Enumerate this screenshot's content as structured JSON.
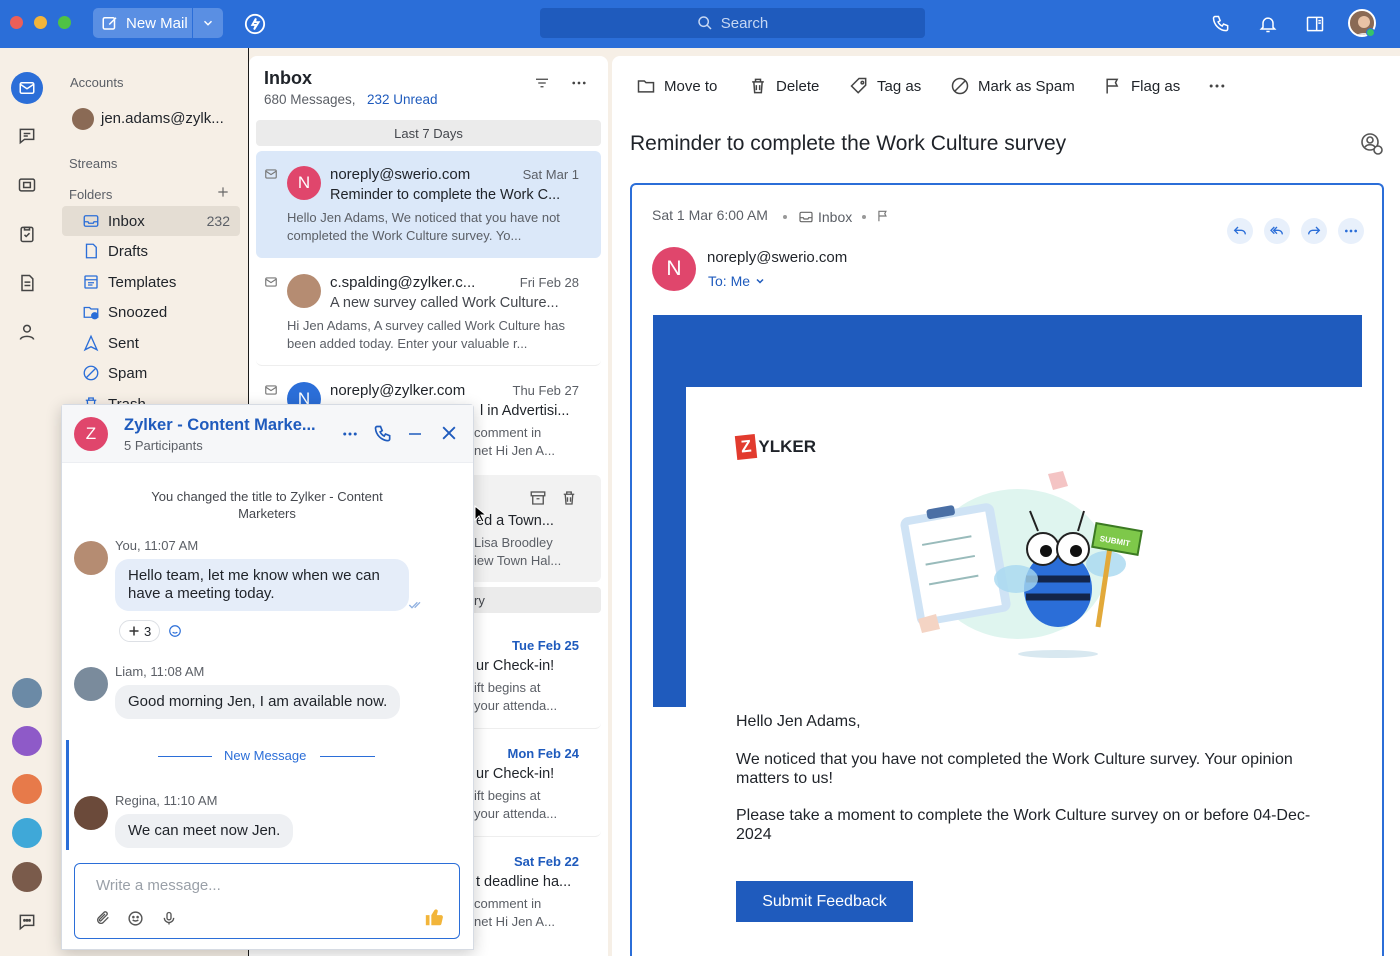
{
  "titlebar": {
    "new_mail_label": "New Mail",
    "search_placeholder": "Search",
    "icons": [
      "compose-icon",
      "chevron-down-icon",
      "lightning-icon",
      "search-icon",
      "phone-icon",
      "bell-icon",
      "reading-pane-icon",
      "avatar"
    ]
  },
  "rail": {
    "icons": [
      "mail-icon",
      "chat-icon",
      "streams-icon",
      "tasks-icon",
      "notes-icon",
      "contacts-icon",
      "chat-bubble-icon"
    ]
  },
  "folders": {
    "accounts_label": "Accounts",
    "account": "jen.adams@zylk...",
    "streams_label": "Streams",
    "folders_label": "Folders",
    "items": [
      {
        "label": "Inbox",
        "count": "232",
        "icon": "inbox-icon"
      },
      {
        "label": "Drafts",
        "count": "",
        "icon": "drafts-icon"
      },
      {
        "label": "Templates",
        "count": "",
        "icon": "templates-icon"
      },
      {
        "label": "Snoozed",
        "count": "",
        "icon": "snoozed-icon"
      },
      {
        "label": "Sent",
        "count": "",
        "icon": "sent-icon"
      },
      {
        "label": "Spam",
        "count": "",
        "icon": "spam-icon"
      },
      {
        "label": "Trash",
        "count": "",
        "icon": "trash-icon"
      }
    ]
  },
  "list": {
    "title": "Inbox",
    "count_text": "680 Messages,",
    "unread_text": "232 Unread",
    "group_last7": "Last 7 Days",
    "group_earlier": "ry",
    "mails": [
      {
        "from": "noreply@swerio.com",
        "date": "Sat Mar 1",
        "subject": "Reminder to complete the Work C...",
        "preview": "Hello Jen Adams, We noticed that you have not completed the Work Culture survey. Yo...",
        "avatar": "N"
      },
      {
        "from": "c.spalding@zylker.c...",
        "date": "Fri Feb 28",
        "subject": "A new survey called Work Culture...",
        "preview": "Hi Jen Adams, A survey called Work Culture has been added today. Enter your valuable r...",
        "avatar": ""
      },
      {
        "from": "noreply@zylker.com",
        "date": "Thu Feb 27",
        "subject": "l in Advertisi...",
        "preview_line1": "comment in",
        "preview_line2": "net Hi Jen A...",
        "avatar": "N"
      },
      {
        "subject": "ed a Town...",
        "preview_line1": "Lisa Broodley",
        "preview_line2": "iew Town Hal..."
      },
      {
        "date": "Tue Feb 25",
        "subject": "ur Check-in!",
        "preview_line1": "ift begins at",
        "preview_line2": "your attenda..."
      },
      {
        "date": "Mon Feb 24",
        "subject": "ur Check-in!",
        "preview_line1": "ift begins at",
        "preview_line2": "your attenda..."
      },
      {
        "date": "Sat Feb 22",
        "subject": "t deadline ha...",
        "preview_line1": "comment in",
        "preview_line2": "net Hi Jen A..."
      }
    ]
  },
  "reader": {
    "toolbar": {
      "move_to": "Move to",
      "delete": "Delete",
      "tag_as": "Tag as",
      "mark_spam": "Mark as Spam",
      "flag_as": "Flag as"
    },
    "subject": "Reminder to complete the Work Culture survey",
    "meta_date": "Sat 1 Mar 6:00 AM",
    "meta_folder": "Inbox",
    "sender": "noreply@swerio.com",
    "sender_avatar": "N",
    "to_label": "To: Me",
    "body": {
      "brand": "YLKER",
      "brand_letter": "Z",
      "sign_text": "SUBMIT",
      "greeting": "Hello Jen Adams,",
      "para1": "We noticed that you have not completed the Work Culture survey. Your opinion matters to us!",
      "para2": "Please take a moment to complete the Work Culture survey on or before 04-Dec-2024",
      "cta": "Submit Feedback"
    },
    "colors": {
      "brand_blue": "#1f5bbd",
      "brand_red": "#e23b2e"
    }
  },
  "chat": {
    "avatar_letter": "Z",
    "title": "Zylker - Content Marke...",
    "participants": "5 Participants",
    "system_msg": "You changed the title to Zylker - Content Marketers",
    "messages": [
      {
        "sender": "You,",
        "time": "11:07 AM",
        "text": "Hello team, let me know when we can have a meeting today."
      },
      {
        "sender": "Liam,",
        "time": "11:08 AM",
        "text": "Good morning Jen, I am available now."
      },
      {
        "sender": "Regina,",
        "time": "11:10 AM",
        "text": "We can meet now Jen."
      }
    ],
    "reaction_count": "3",
    "new_message_label": "New Message",
    "input_placeholder": "Write a message..."
  }
}
